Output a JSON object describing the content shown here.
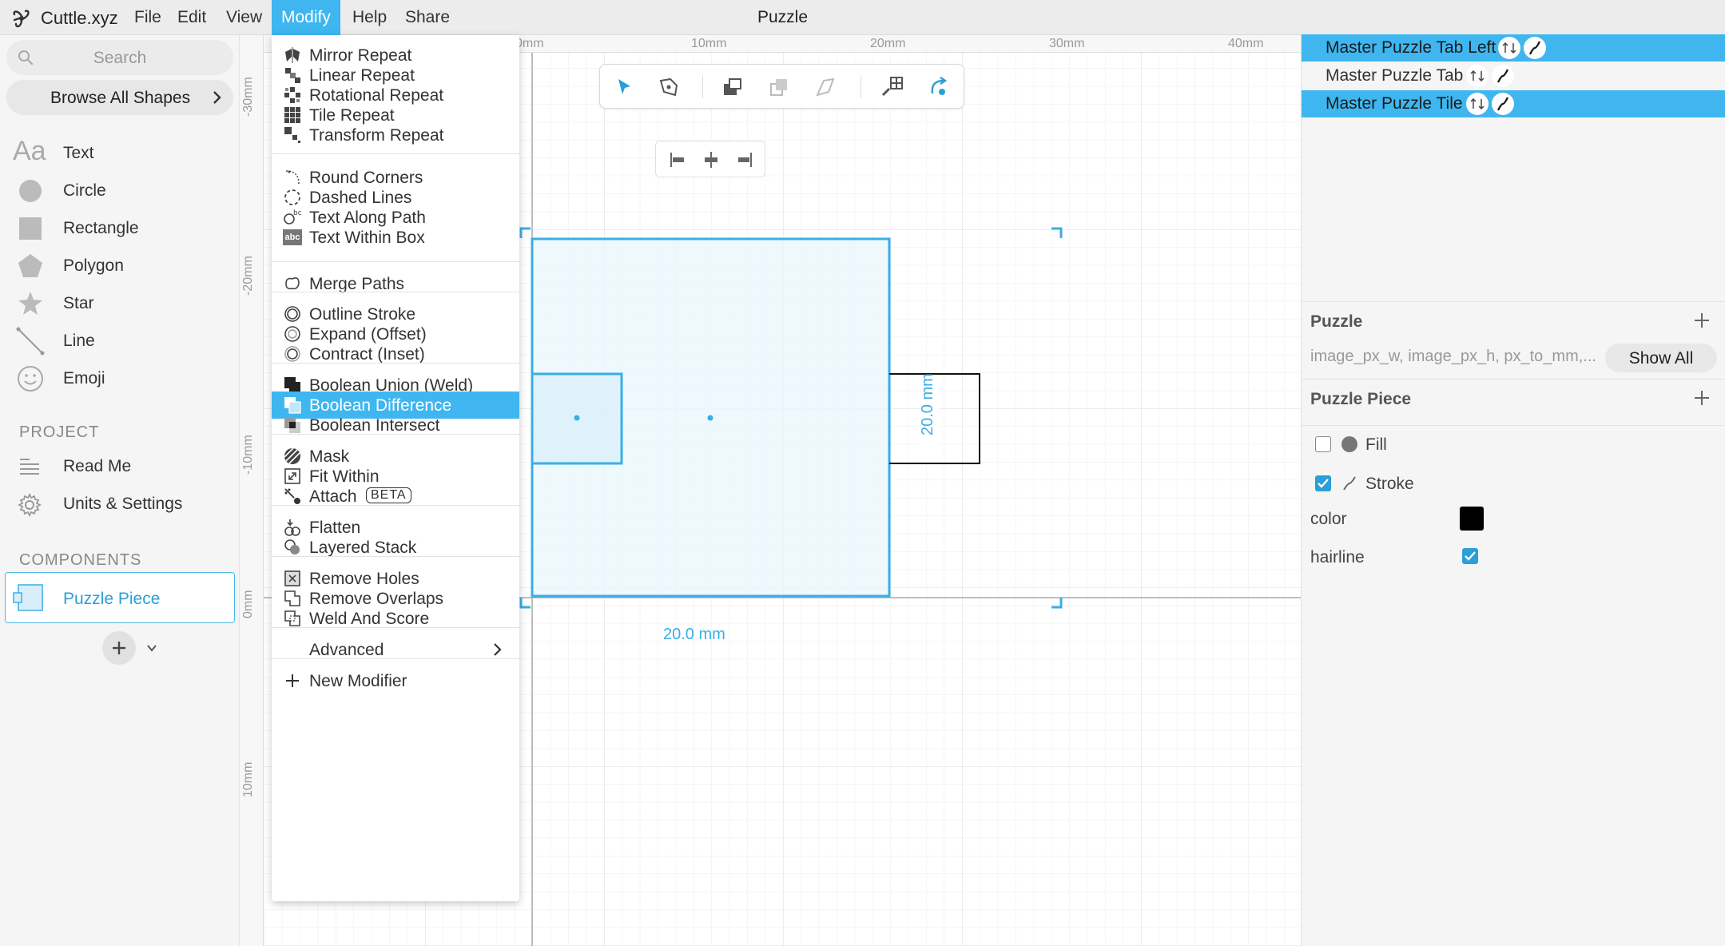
{
  "colors": {
    "accent": "#3fb6ef",
    "shape_fill": "#eaf6fd",
    "shape_stroke": "#3aaee6",
    "stroke_color": "#000000"
  },
  "menubar": {
    "app_name": "Cuttle.xyz",
    "items": [
      "File",
      "Edit",
      "View",
      "Modify",
      "Help",
      "Share"
    ],
    "active": "Modify",
    "document_title": "Puzzle"
  },
  "left_panel": {
    "search_placeholder": "Search",
    "browse_label": "Browse All Shapes",
    "shapes": [
      "Text",
      "Circle",
      "Rectangle",
      "Polygon",
      "Star",
      "Line",
      "Emoji"
    ],
    "text_icon_glyph": "Aa",
    "project_title": "PROJECT",
    "project_items": [
      "Read Me",
      "Units & Settings"
    ],
    "components_title": "COMPONENTS",
    "component": "Puzzle Piece"
  },
  "rulers": {
    "top": [
      "0mm",
      "10mm",
      "20mm",
      "30mm",
      "40mm"
    ],
    "left": [
      "-30mm",
      "-20mm",
      "-10mm",
      "0mm",
      "10mm"
    ]
  },
  "toolbar": {
    "tools": [
      "select-arrow-icon",
      "pen-tool-icon",
      "bring-forward-icon",
      "duplicate-icon",
      "send-backward-icon",
      "link-repeat-icon",
      "rotate-tool-icon"
    ]
  },
  "align_bar": {
    "tools": [
      "align-left-icon",
      "align-center-icon",
      "align-right-icon"
    ]
  },
  "canvas": {
    "dim_width": "20.0 mm",
    "dim_height": "20.0 mm"
  },
  "modify_menu": {
    "items": [
      "Mirror Repeat",
      "Linear Repeat",
      "Rotational Repeat",
      "Tile Repeat",
      "Transform Repeat",
      "Round Corners",
      "Dashed Lines",
      "Text Along Path",
      "Text Within Box",
      "Merge Paths",
      "Outline Stroke",
      "Expand (Offset)",
      "Contract (Inset)",
      "Boolean Union (Weld)",
      "Boolean Difference",
      "Boolean Intersect",
      "Mask",
      "Fit Within",
      "Attach",
      "Flatten",
      "Layered Stack",
      "Remove Holes",
      "Remove Overlaps",
      "Weld And Score",
      "Advanced",
      "New Modifier"
    ],
    "highlighted": "Boolean Difference",
    "beta_badge": "BETA",
    "text_within_box_icon": "abc"
  },
  "right_panel": {
    "layers": [
      {
        "label": "Master Puzzle Tab Left",
        "selected": true
      },
      {
        "label": "Master Puzzle Tab",
        "selected": false
      },
      {
        "label": "Master Puzzle Tile",
        "selected": true
      }
    ],
    "puzzle_title": "Puzzle",
    "puzzle_params": "image_px_w, image_px_h, px_to_mm,...",
    "show_all_label": "Show All",
    "piece_title": "Puzzle Piece",
    "fill_label": "Fill",
    "fill_checked": false,
    "stroke_label": "Stroke",
    "stroke_checked": true,
    "color_label": "color",
    "hairline_label": "hairline",
    "hairline_checked": true
  }
}
